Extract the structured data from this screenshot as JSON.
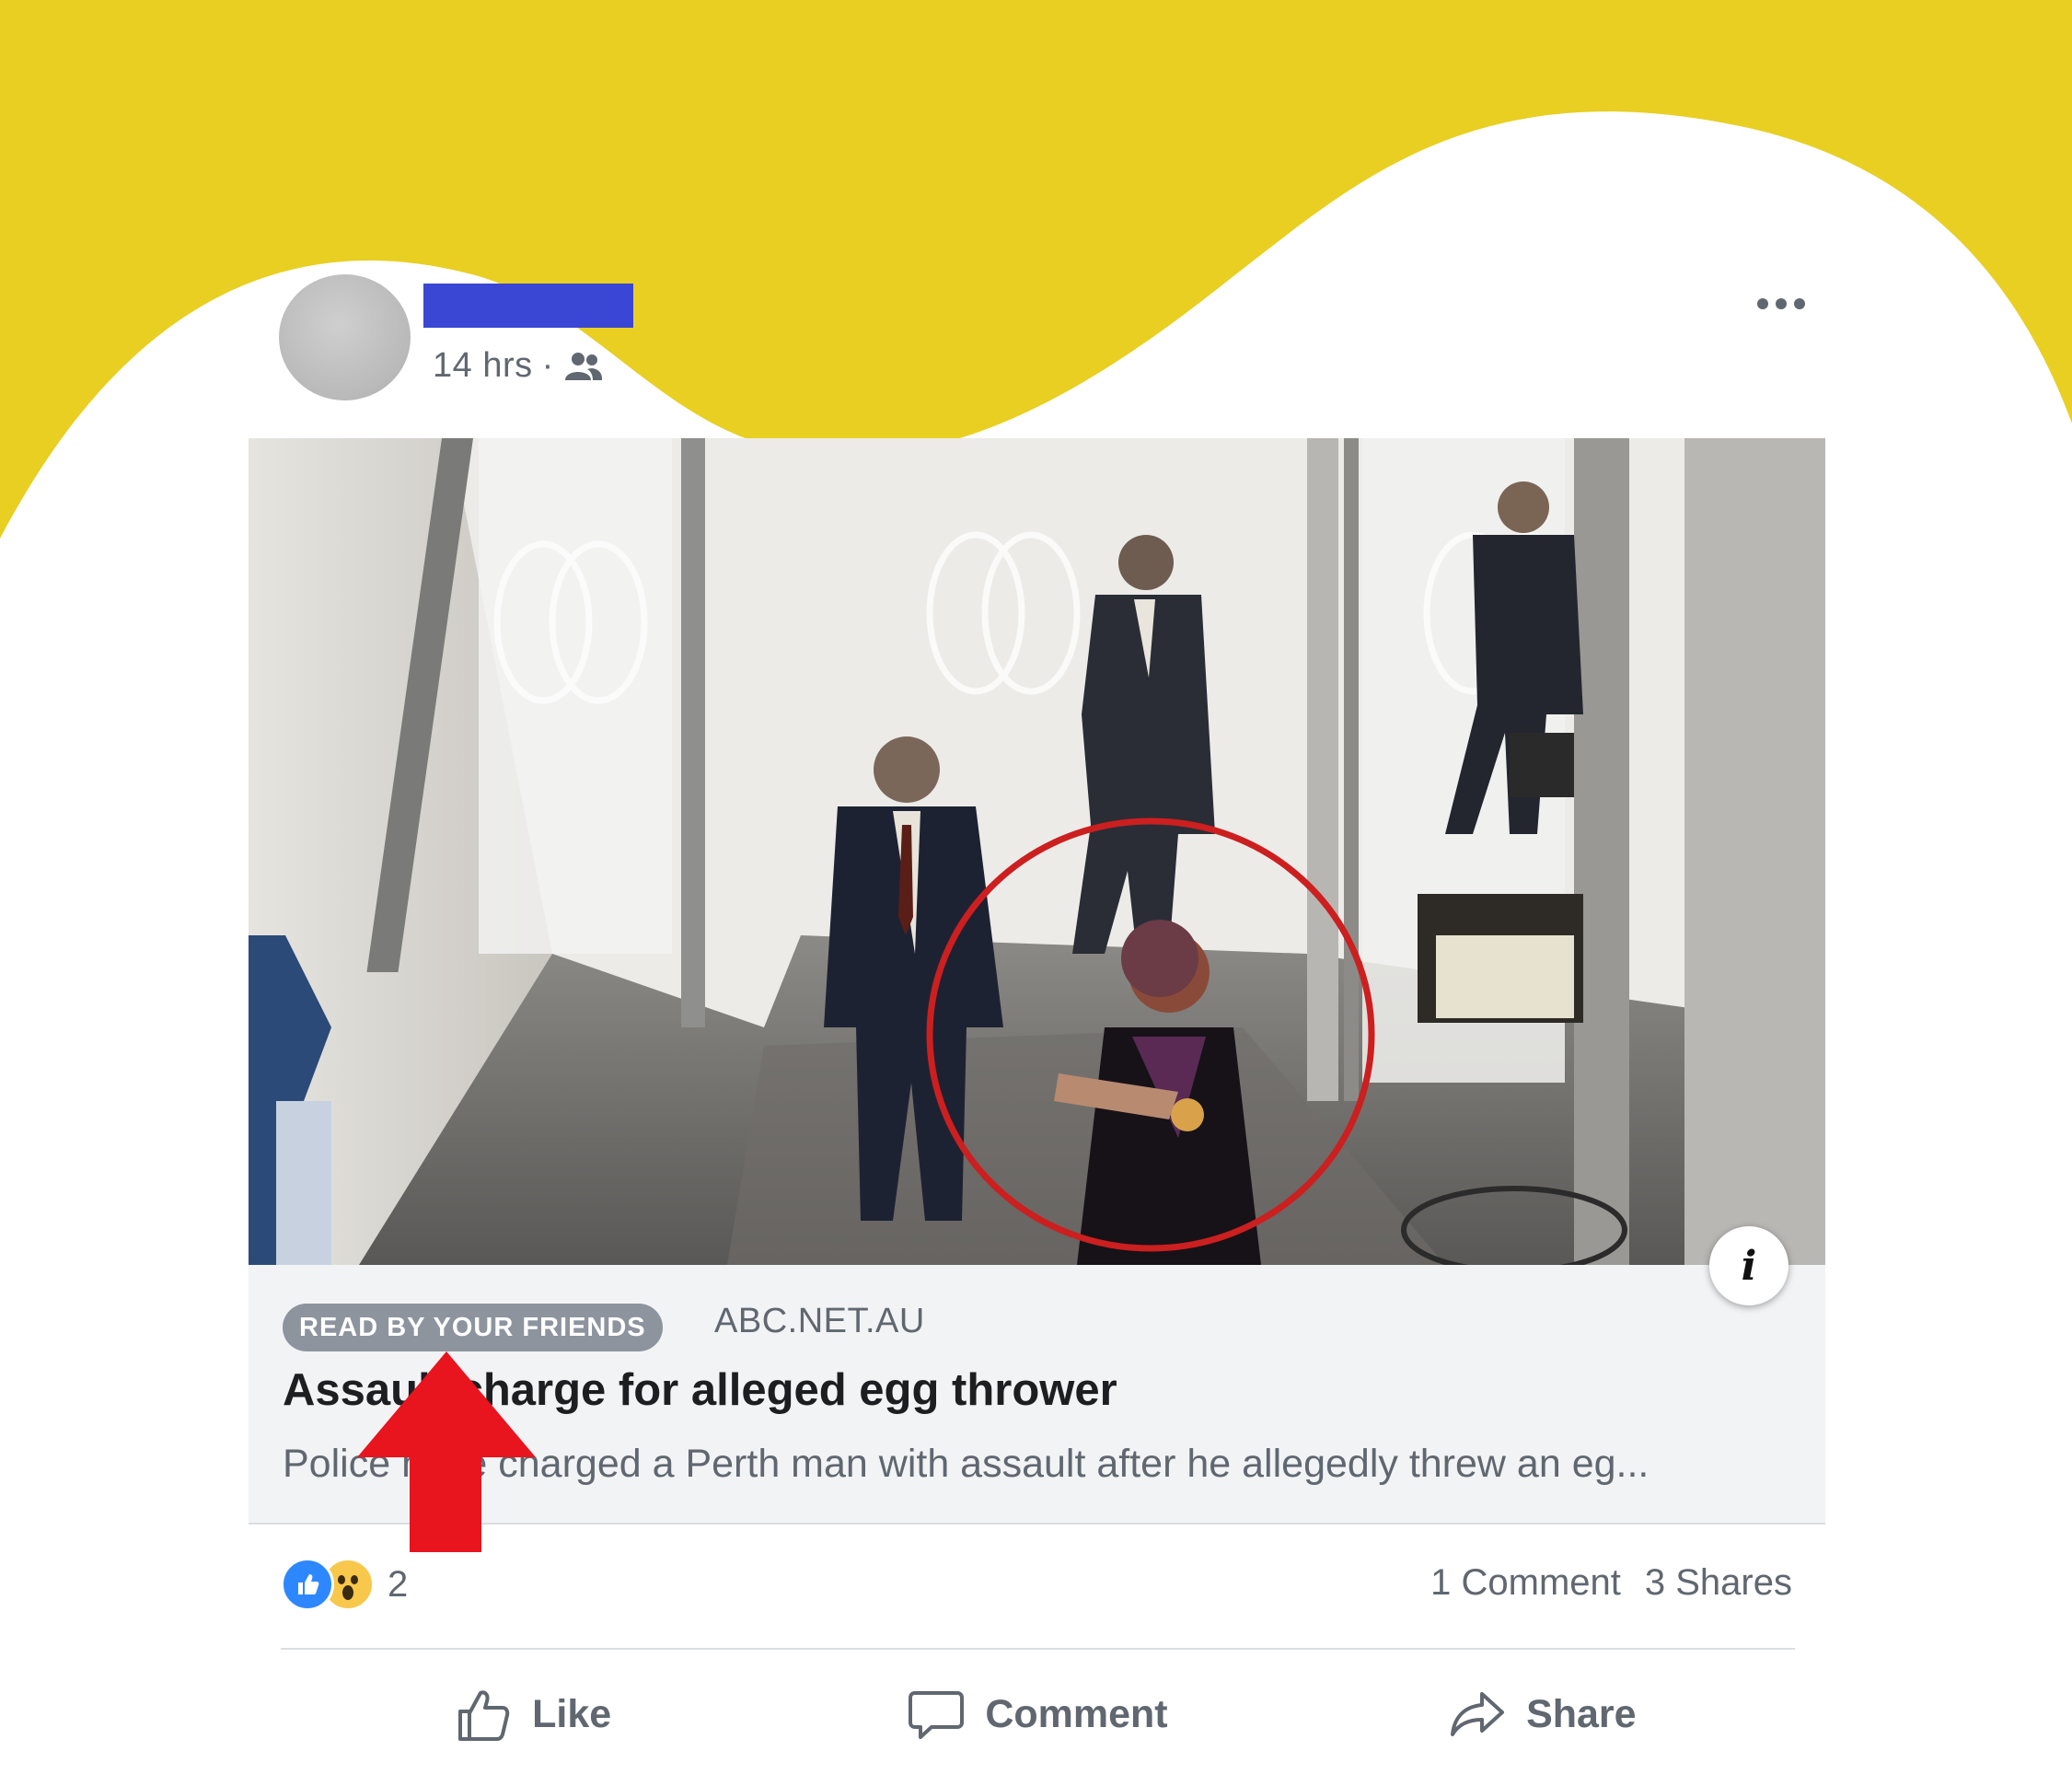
{
  "colors": {
    "background_accent": "#e8cf22",
    "name_redaction": "#3a46d4",
    "badge_bg": "#8d949e",
    "link_box_bg": "#f2f3f5",
    "highlight_circle": "#cc1f1f",
    "arrow": "#e8141e",
    "like_blue": "#2d88ff"
  },
  "post": {
    "timestamp": "14 hrs",
    "separator": "·",
    "audience_icon": "friends-icon",
    "more_icon": "more-dots-icon"
  },
  "media": {
    "description_icon": "info-icon",
    "info_label": "i"
  },
  "link": {
    "badge": "READ BY YOUR FRIENDS",
    "domain": "ABC.NET.AU",
    "headline": "Assault charge for alleged egg thrower",
    "description": "Police have charged a Perth man with assault after he allegedly threw an eg..."
  },
  "engagement": {
    "reactions": [
      "like",
      "wow"
    ],
    "reaction_count": "2",
    "comments": "1 Comment",
    "shares": "3 Shares"
  },
  "actions": {
    "like": "Like",
    "comment": "Comment",
    "share": "Share"
  }
}
